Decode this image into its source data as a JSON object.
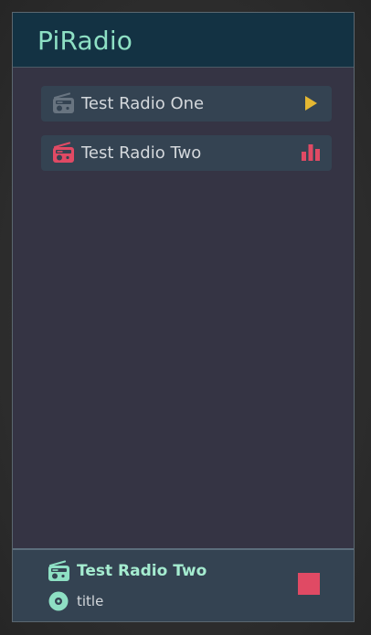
{
  "app": {
    "title": "PiRadio"
  },
  "stations": [
    {
      "name": "Test Radio One",
      "icon": "radio-icon",
      "icon_color": "#687480",
      "state": "play",
      "state_icon": "play-icon",
      "state_color": "#e4b732"
    },
    {
      "name": "Test Radio Two",
      "icon": "radio-icon",
      "icon_color": "#e04a64",
      "state": "playing",
      "state_icon": "equalizer-icon",
      "state_color": "#e04a64"
    }
  ],
  "player": {
    "station_name": "Test Radio Two",
    "station_icon": "radio-icon",
    "track_icon": "disc-icon",
    "track_title": "title",
    "stop_icon": "stop-icon",
    "accent_color": "#8ee0c4",
    "stop_color": "#e04a64"
  }
}
